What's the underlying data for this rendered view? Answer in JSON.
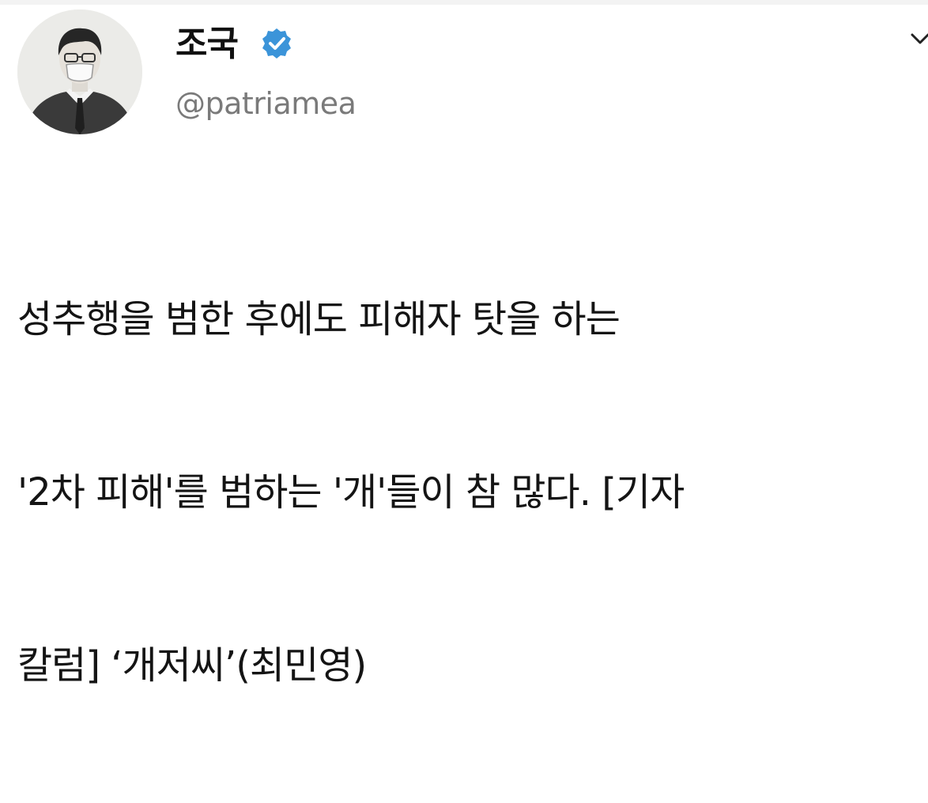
{
  "tweet": {
    "author": {
      "display_name": "조국",
      "handle": "@patriamea",
      "verified": true
    },
    "text_lines": [
      "성추행을 범한 후에도 피해자 탓을 하는",
      "'2차 피해'를 범하는 '개'들이 참 많다. [기자",
      "칼럼] ‘개저씨’(최민영)"
    ]
  },
  "colors": {
    "verified_badge": "#3b94d9",
    "handle": "#7a7a7a",
    "text": "#141414"
  },
  "icons": {
    "verified": "verified-badge-icon",
    "menu": "menu-icon",
    "avatar": "avatar"
  }
}
